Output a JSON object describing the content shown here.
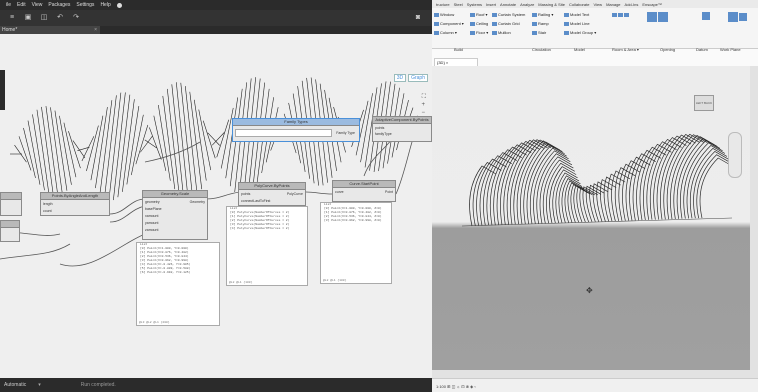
{
  "dynamo": {
    "menu": [
      "ile",
      "Edit",
      "View",
      "Packages",
      "Settings",
      "Help"
    ],
    "help_icon": "help-circle-icon",
    "toolbar_icons": [
      "menu-icon",
      "save-icon",
      "undo-icon",
      "redo-icon"
    ],
    "camera_icon": "camera-icon",
    "tab_label": "Home*",
    "view_icons": [
      "3D",
      "Graph"
    ],
    "nav": {
      "fit": "⛶",
      "zoom_in": "+",
      "zoom_out": "−",
      "pan": "✥"
    },
    "nodes": [
      {
        "id": "familytypes",
        "title": "Family Types",
        "outputs": [
          "Family Type"
        ]
      },
      {
        "id": "adaptivecomponent",
        "title": "AdaptiveComponent.ByPoints",
        "inputs": [
          "points",
          "familyType"
        ]
      },
      {
        "id": "pointsbyangle",
        "title": "Points.ByAngleAndLength",
        "inputs": [
          "length",
          "count"
        ]
      },
      {
        "id": "geometryscale",
        "title": "Geometry.Scale",
        "inputs": [
          "geometry",
          "basePlane",
          "xamount",
          "yamount",
          "zamount"
        ],
        "outputs": [
          "Geometry"
        ]
      },
      {
        "id": "polycurve",
        "title": "PolyCurve.ByPoints",
        "inputs": [
          "points",
          "connectLastToFirst"
        ],
        "outputs": [
          "PolyCurve"
        ]
      },
      {
        "id": "curvestartpoint",
        "title": "Curve.StartPoint",
        "inputs": [
          "curve"
        ],
        "outputs": [
          "Point"
        ]
      }
    ],
    "watch_list_1": [
      "List",
      "[0] Point(X=1.000, Y=0.000)",
      "[1] Point(X=0.876, Y=0.482)",
      "[2] Point(X=0.536, Y=0.844)",
      "[3] Point(X=0.062, Y=0.998)",
      "[4] Point(X=-0.426, Y=0.905)",
      "[5] Point(X=-0.809, Y=0.588)",
      "[6] Point(X=-0.992, Y=0.125)",
      "[7] Point(X=-0.930, Y=-0.368)"
    ],
    "watch_list_1_footer": "@L3 @L2 @L1  {200}",
    "watch_list_2": [
      "List",
      "[0] PolyCurve(NumberOfCurves = 2)",
      "[1] PolyCurve(NumberOfCurves = 2)",
      "[2] PolyCurve(NumberOfCurves = 2)",
      "[3] PolyCurve(NumberOfCurves = 2)",
      "[4] PolyCurve(NumberOfCurves = 2)",
      "[5] PolyCurve(NumberOfCurves = 2)"
    ],
    "watch_list_2_footer": "@L2 @L1  {100}",
    "watch_list_3": [
      "List",
      "[0] Point(X=1.000, Y=0.000, Z=0)",
      "[1] Point(X=0.876, Y=0.482, Z=0)",
      "[2] Point(X=0.536, Y=0.844, Z=0)",
      "[3] Point(X=0.062, Y=0.998, Z=0)",
      "[4] Point(X=-0.426, Y=0.905, Z=0)"
    ],
    "watch_list_3_footer": "@L2 @L1  {100}",
    "status": {
      "run_mode": "Automatic",
      "chevron": "▾",
      "message": "Run completed."
    }
  },
  "revit": {
    "menu": [
      "tructure",
      "Steel",
      "Systems",
      "Insert",
      "Annotate",
      "Analyze",
      "Massing & Site",
      "Collaborate",
      "View",
      "Manage",
      "Add-Ins",
      "Enscape™"
    ],
    "ribbon_items": [
      [
        "Window",
        "Roof ▾",
        "Curtain System",
        "Railing ▾",
        "Model Text"
      ],
      [
        "Component ▾",
        "Ceiling",
        "Curtain Grid",
        "Ramp",
        "Model Line"
      ],
      [
        "Column ▾",
        "Floor ▾",
        "Mullion",
        "Stair",
        "Model Group ▾"
      ]
    ],
    "panel_labels": [
      "Build",
      "Circulation",
      "Model",
      "Room & Area ▾",
      "Opening",
      "Datum",
      "Work Plane"
    ],
    "view_tab": "{3D}",
    "viewcube_label": "LEFT  BACK",
    "status_icons": "1:100 ⊞ ◫ ☼ ⊡ ⊗ ◈ ‹"
  }
}
